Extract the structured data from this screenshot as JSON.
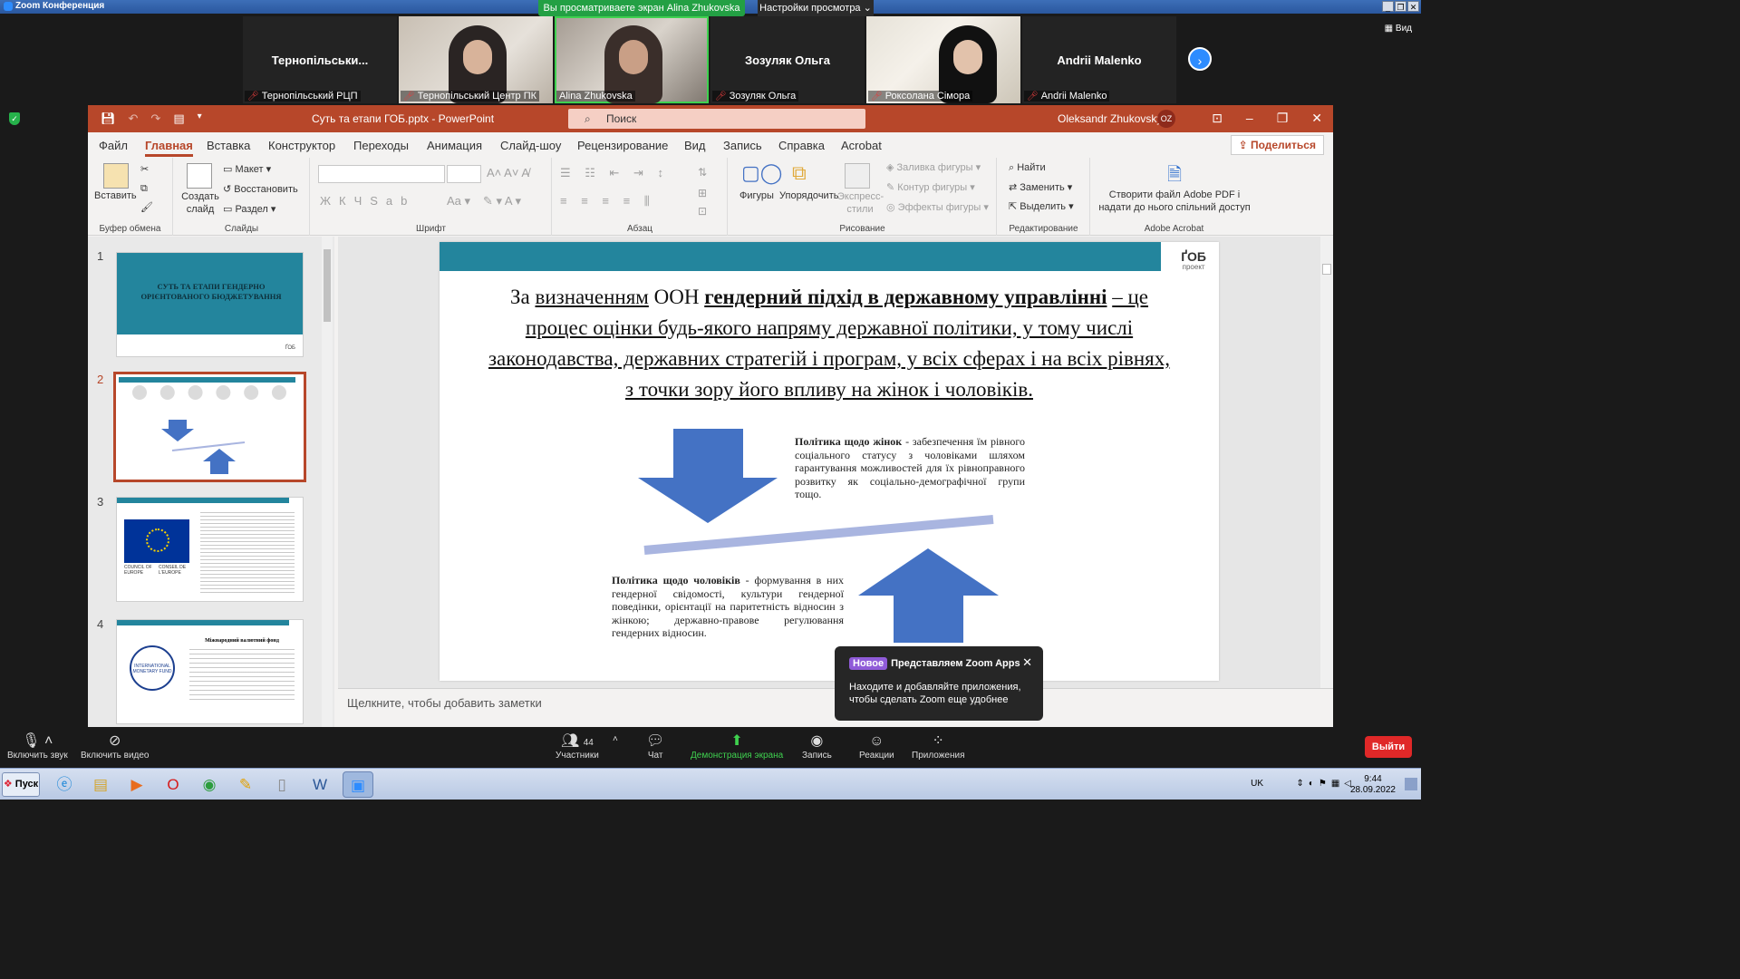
{
  "zoom": {
    "title": "Zoom Конференция",
    "banner": "Вы просматриваете экран Alina Zhukovska",
    "view_options": "Настройки просмотра",
    "view_label": "Вид",
    "participants": [
      {
        "big_name": "Тернопільськи...",
        "label": "Тернопільський РЦП",
        "video": false
      },
      {
        "big_name": "",
        "label": "Тернопільський Центр ПК",
        "video": true
      },
      {
        "big_name": "",
        "label": "Alina Zhukovska",
        "video": true
      },
      {
        "big_name": "Зозуляк Ольга",
        "label": "Зозуляк Ольга",
        "video": false
      },
      {
        "big_name": "",
        "label": "Роксолана Сімора",
        "video": true
      },
      {
        "big_name": "Andrii Malenko",
        "label": "Andrii Malenko",
        "video": false
      }
    ],
    "controls": {
      "mute": "Включить звук",
      "video": "Включить видео",
      "participants": "Участники",
      "participants_count": "44",
      "chat": "Чат",
      "share": "Демонстрация экрана",
      "record": "Запись",
      "reactions": "Реакции",
      "apps": "Приложения",
      "leave": "Выйти"
    },
    "toast": {
      "badge": "Новое",
      "title": "Представляем Zoom Apps",
      "message": "Находите и добавляйте приложения, чтобы сделать Zoom еще удобнее"
    }
  },
  "ppt": {
    "filename": "Суть та етапи ГОБ.pptx  -  PowerPoint",
    "search_placeholder": "Поиск",
    "user": "Oleksandr Zhukovsky",
    "user_initials": "OZ",
    "share": "Поделиться",
    "tabs": [
      "Файл",
      "Главная",
      "Вставка",
      "Конструктор",
      "Переходы",
      "Анимация",
      "Слайд-шоу",
      "Рецензирование",
      "Вид",
      "Запись",
      "Справка",
      "Acrobat"
    ],
    "ribbon": {
      "paste": "Вставить",
      "clipboard": "Буфер обмена",
      "new_slide": "Создать слайд",
      "layout": "Макет",
      "reset": "Восстановить",
      "section": "Раздел",
      "slides": "Слайды",
      "font": "Шрифт",
      "paragraph": "Абзац",
      "shapes": "Фигуры",
      "arrange": "Упорядочить",
      "quick_styles": "Экспресс-стили",
      "shape_fill": "Заливка фигуры",
      "shape_outline": "Контур фигуры",
      "shape_effects": "Эффекты фигуры",
      "drawing": "Рисование",
      "find": "Найти",
      "replace": "Заменить",
      "select": "Выделить",
      "editing": "Редактирование",
      "acrobat_btn": "Створити файл Adobe PDF і надати до нього спільний доступ",
      "adobe": "Adobe Acrobat"
    },
    "thumbnails": {
      "n1": "1",
      "n2": "2",
      "n3": "3",
      "n4": "4",
      "s1_title": "СУТЬ ТА ЕТАПИ ГЕНДЕРНО ОРІЄНТОВАНОГО БЮДЖЕТУВАННЯ",
      "s3_coe1": "COUNCIL OF EUROPE",
      "s3_coe2": "CONSEIL DE L'EUROPE",
      "s4_title": "Міжнародний валютний фонд",
      "s4_seal": "INTERNATIONAL MONETARY FUND"
    },
    "slide": {
      "logo": "ҐОБ",
      "logo_sub": "проект",
      "q1": "За ",
      "q2": "визначенням",
      "q3": " ООН ",
      "q4": "гендерний підхід в державному управлінні",
      "q5": "– це процес оцінки будь-якого напряму державної політики, у тому числі законодавства, державних стратегій і програм, у всіх сферах і на всіх рівнях, з точки зору його впливу на жінок і чоловіків.",
      "women_bold": "Політика щодо жінок",
      "women_text": " - забезпечення їм рівного соціального статусу з чоловіками шляхом гарантування можливостей для їх рівноправного розвитку як соціально-демографічної групи тощо.",
      "men_bold": "Політика щодо чоловіків",
      "men_text": " - формування в них гендерної свідомості, культури гендерної поведінки, орієнтації на паритетність відносин з жінкою; державно-правове регулювання гендерних відносин."
    },
    "notes_placeholder": "Щелкните, чтобы добавить заметки"
  },
  "taskbar": {
    "start": "Пуск",
    "lang": "UK",
    "time": "9:44",
    "date": "28.09.2022"
  },
  "colors": {
    "accent": "#b7472a",
    "teal": "#23859d",
    "arrow": "#4472c4",
    "zoom_green": "#23a044"
  }
}
